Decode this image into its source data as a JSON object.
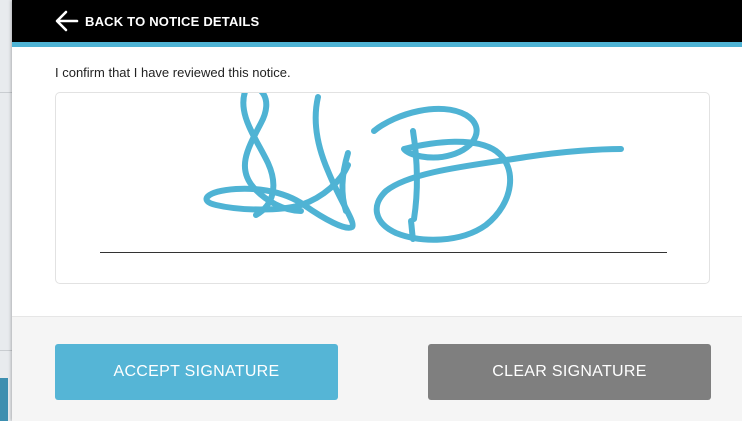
{
  "header": {
    "back_label": "BACK TO NOTICE DETAILS",
    "back_icon": "arrow-left-icon"
  },
  "confirmation": {
    "text": "I confirm that I have reviewed this notice."
  },
  "signature": {
    "ink_color": "#4fb3d4",
    "drawn_mark": "GB"
  },
  "footer": {
    "accept_label": "ACCEPT SIGNATURE",
    "clear_label": "CLEAR SIGNATURE"
  },
  "colors": {
    "accent": "#4fb3d4",
    "accept_button": "#55b5d6",
    "clear_button": "#7f7f7f",
    "header_bg": "#000000"
  }
}
